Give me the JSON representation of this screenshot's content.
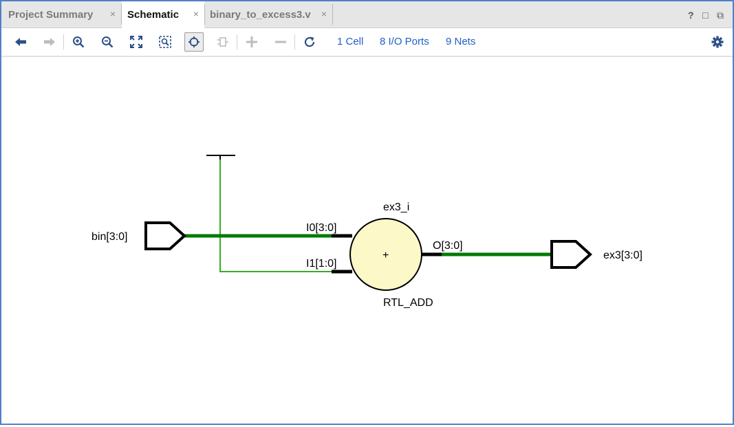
{
  "tabs": [
    {
      "label": "Project Summary",
      "close": "×"
    },
    {
      "label": "Schematic",
      "close": "×"
    },
    {
      "label": "binary_to_excess3.v",
      "close": "×"
    }
  ],
  "window_controls": {
    "help": "?",
    "maximize": "□",
    "float": "⧉"
  },
  "toolbar": {
    "icons": [
      "back-arrow-icon",
      "forward-arrow-icon",
      "zoom-in-icon",
      "zoom-out-icon",
      "zoom-fit-icon",
      "zoom-area-icon",
      "select-mode-icon",
      "ports-icon",
      "expand-icon",
      "collapse-icon",
      "refresh-icon",
      "settings-icon"
    ],
    "cells_link": "1 Cell",
    "ports_link": "8 I/O Ports",
    "nets_link": "9 Nets"
  },
  "schematic": {
    "input_port": "bin[3:0]",
    "output_port": "ex3[3:0]",
    "cell": {
      "instance_name": "ex3_i",
      "type": "RTL_ADD",
      "symbol": "+",
      "pin_i0": "I0[3:0]",
      "pin_i1": "I1[1:0]",
      "pin_o": "O[3:0]"
    },
    "colors": {
      "bus_wire": "#007a00",
      "net_wire": "#3aaa2a",
      "cell_fill": "#fcf8c8",
      "port_outline": "#000000"
    }
  }
}
